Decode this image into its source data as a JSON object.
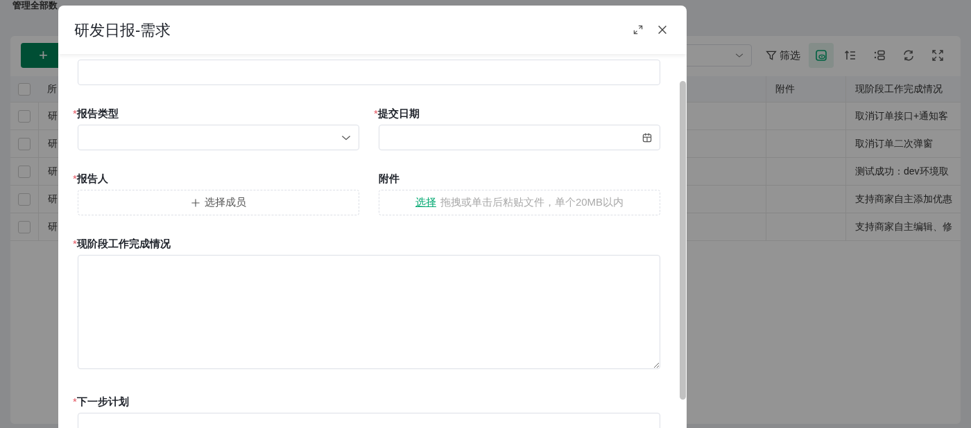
{
  "background_page": {
    "title": "管理全部数",
    "toolbar": {
      "add_button": "+",
      "filter_button": "筛选",
      "icon_buttons": [
        {
          "kind": "view",
          "selected": true
        },
        {
          "kind": "sort",
          "selected": false
        },
        {
          "kind": "columns",
          "selected": false
        },
        {
          "kind": "refresh",
          "selected": false
        },
        {
          "kind": "fullscreen",
          "selected": false
        }
      ]
    },
    "table": {
      "select_all_checked": false,
      "columns": [
        "所",
        "附件",
        "现阶段工作完成情况"
      ],
      "rows": [
        {
          "checked": false,
          "column_1": "研",
          "progress": "取消订单接口+通知客"
        },
        {
          "checked": false,
          "column_1": "研",
          "progress": "取消订单二次弹窗"
        },
        {
          "checked": false,
          "column_1": "研",
          "progress": "测试成功：dev环境取"
        },
        {
          "checked": false,
          "column_1": "研",
          "progress": "支持商家自主添加优惠"
        },
        {
          "checked": false,
          "column_1": "研",
          "progress": "支持商家自主编辑、修"
        }
      ]
    }
  },
  "modal": {
    "title": "研发日报-需求",
    "fields": [
      {
        "kind": "input"
      },
      {
        "kind": "select",
        "label": "报告类型",
        "required_mark": "*"
      },
      {
        "kind": "date",
        "label": "提交日期",
        "required_mark": "*"
      },
      {
        "kind": "member",
        "label": "报告人",
        "required_mark": "*",
        "button": "选择成员"
      },
      {
        "kind": "upload",
        "label": "附件",
        "link": "选择",
        "hint": "拖拽或单击后粘贴文件，单个20MB以内"
      },
      {
        "kind": "textarea",
        "label": "现阶段工作完成情况",
        "required_mark": "*"
      },
      {
        "kind": "textarea",
        "label": "下一步计划",
        "required_mark": "*"
      }
    ]
  }
}
